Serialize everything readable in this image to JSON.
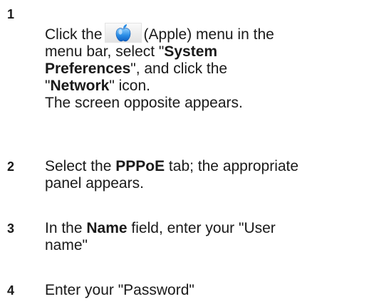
{
  "steps": [
    {
      "number": "1",
      "l1_a": "Click the",
      "l1_b": "(Apple) menu in the",
      "l2": "menu bar, select \"",
      "l2_bold": "System",
      "l3_bold": "Preferences",
      "l3_rest": "\", and click the",
      "l4_a": "\"",
      "l4_bold": "Network",
      "l4_rest": "\" icon.",
      "l5": "The screen opposite appears.",
      "icon": "apple-icon"
    },
    {
      "number": "2",
      "l1_a": "Select the ",
      "l1_bold": "PPPoE",
      "l1_rest": " tab; the appropriate",
      "l2": "panel appears."
    },
    {
      "number": "3",
      "l1_a": "In the ",
      "l1_bold": "Name",
      "l1_rest": " field, enter your \"User",
      "l2": "name\""
    },
    {
      "number": "4",
      "l1": "Enter your \"Password\""
    }
  ]
}
